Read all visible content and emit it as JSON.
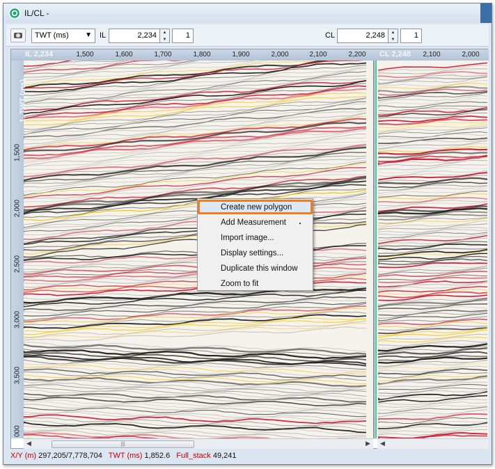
{
  "window": {
    "title": "IL/CL -"
  },
  "toolbar": {
    "domain_select": "TWT (ms)",
    "il_label": "IL",
    "il_value": "2,234",
    "il_step": "1",
    "cl_label": "CL",
    "cl_value": "2,248",
    "cl_step": "1"
  },
  "inline_panel": {
    "label": "IL 2,234",
    "x_ticks": [
      "1,500",
      "1,600",
      "1,700",
      "1,800",
      "1,900",
      "2,000",
      "2,100",
      "2,200"
    ]
  },
  "crossline_panel": {
    "label": "CL 2,248",
    "x_ticks": [
      "2,100",
      "2,000"
    ]
  },
  "y_axis": {
    "title": "1, TWT (ms)",
    "ticks": [
      "1,500",
      "2,000",
      "2,500",
      "3,000",
      "3,500",
      "000"
    ]
  },
  "context_menu": {
    "items": [
      "Create new polygon",
      "Add Measurement",
      "Import image...",
      "Display settings...",
      "Duplicate this window",
      "Zoom to fit"
    ]
  },
  "status_bar": {
    "xy_label": "X/Y (m)",
    "xy_value": "297,205/7,778,704",
    "twt_label": "TWT (ms)",
    "twt_value": "1,852.6",
    "stack_label": "Full_stack",
    "stack_value": "49,241"
  },
  "colors": {
    "window_frame": "#dbe6f2",
    "highlight_border": "#f07d1e",
    "status_key": "#c00000",
    "cursor_line": "#3cc8a0"
  },
  "icons": [
    "app-logo-icon",
    "camera-icon",
    "dropdown-arrow-icon",
    "spin-up-icon",
    "spin-down-icon",
    "scroll-left-icon",
    "scroll-right-icon"
  ]
}
